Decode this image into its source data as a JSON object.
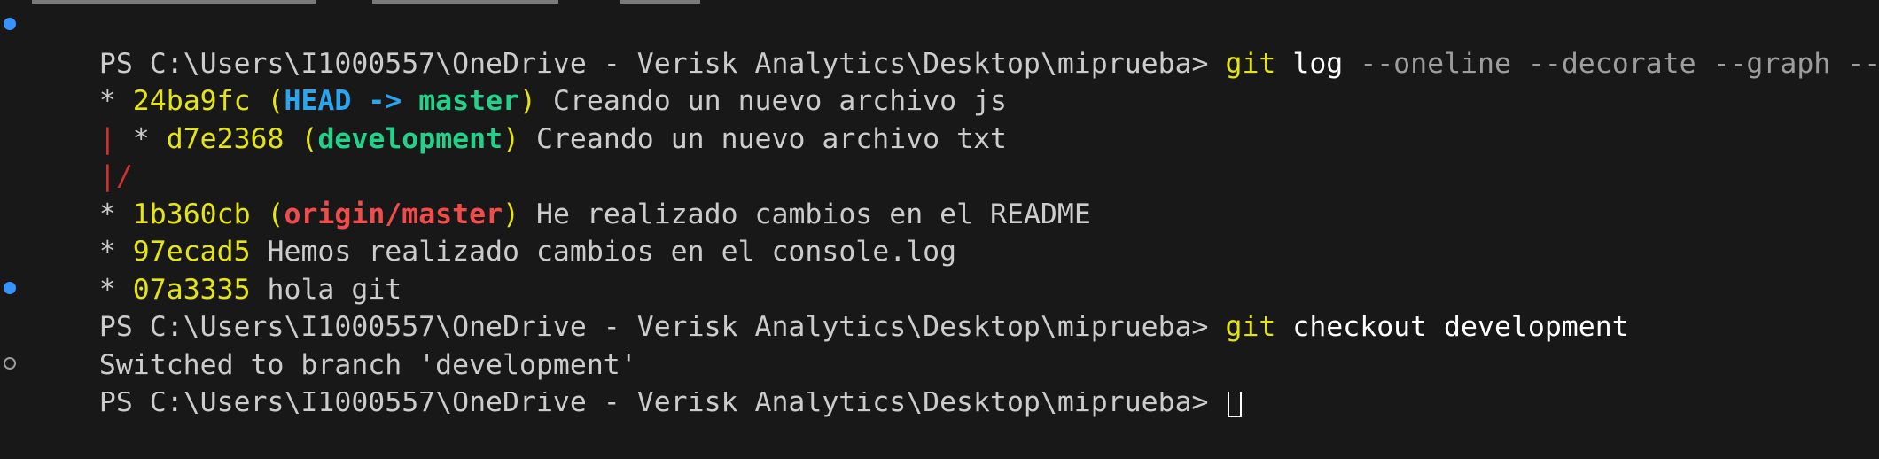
{
  "prompt": "PS C:\\Users\\I1000557\\OneDrive - Verisk Analytics\\Desktop\\miprueba>",
  "commands": {
    "log": {
      "git": "git",
      "sub": "log",
      "flags": "--oneline --decorate --graph --all"
    },
    "checkout": {
      "git": "git",
      "sub": "checkout development"
    }
  },
  "log": [
    {
      "graph": "* ",
      "hash": "24ba9fc",
      "refs": [
        {
          "text": "HEAD -> ",
          "color": "blue"
        },
        {
          "text": "master",
          "color": "green"
        }
      ],
      "message": "Creando un nuevo archivo js"
    },
    {
      "graph_bar": "| ",
      "graph": "* ",
      "hash": "d7e2368",
      "refs": [
        {
          "text": "development",
          "color": "green"
        }
      ],
      "message": "Creando un nuevo archivo txt"
    },
    {
      "graph_only": "|/"
    },
    {
      "graph": "* ",
      "hash": "1b360cb",
      "refs": [
        {
          "text": "origin/master",
          "color": "red"
        }
      ],
      "message": "He realizado cambios en el README"
    },
    {
      "graph": "* ",
      "hash": "97ecad5",
      "message": "Hemos realizado cambios en el console.log"
    },
    {
      "graph": "* ",
      "hash": "07a3335",
      "message": "hola git"
    }
  ],
  "output_switched": "Switched to branch 'development'",
  "colors": {
    "background": "#181818",
    "text": "#cccccc",
    "yellow": "#e5e510",
    "blue": "#2aa6f0",
    "green": "#23d18b",
    "red": "#f14c4c",
    "graph_red": "#cd3131",
    "decoration_success": "#3794ff"
  },
  "icons": {
    "decoration_success": "filled-circle-icon",
    "decoration_pending": "hollow-circle-icon",
    "cursor": "block-cursor-icon"
  }
}
